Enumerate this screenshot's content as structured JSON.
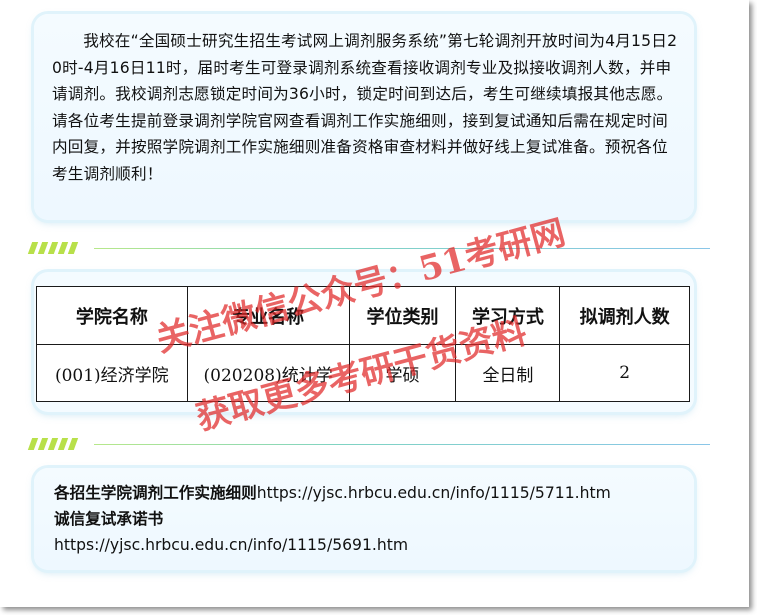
{
  "notice": {
    "text": "我校在“全国硕士研究生招生考试网上调剂服务系统”第七轮调剂开放时间为4月15日20时-4月16日11时，届时考生可登录调剂系统查看接收调剂专业及拟接收调剂人数，并申请调剂。我校调剂志愿锁定时间为36小时，锁定时间到达后，考生可继续填报其他志愿。请各位考生提前登录调剂学院官网查看调剂工作实施细则，接到复试通知后需在规定时间内回复，并按照学院调剂工作实施细则准备资格审查材料并做好线上复试准备。预祝各位考生调剂顺利！"
  },
  "table": {
    "headers": [
      "学院名称",
      "专业名称",
      "学位类别",
      "学习方式",
      "拟调剂人数"
    ],
    "rows": [
      [
        "(001)经济学院",
        "(020208)统计学",
        "学硕",
        "全日制",
        "2"
      ]
    ]
  },
  "links": {
    "rule_label": "各招生学院调剂工作实施细则",
    "rule_url": "https://yjsc.hrbcu.edu.cn/info/1115/5711.htm",
    "pledge_label": "诚信复试承诺书",
    "pledge_url": "https://yjsc.hrbcu.edu.cn/info/1115/5691.htm"
  },
  "watermark": {
    "line1": "关注微信公众号：51考研网",
    "line2": "获取更多考研干货资料"
  },
  "colors": {
    "accent_green": "#b8e04a",
    "card_bg": "#f4fbff",
    "watermark_red": "#e02828"
  }
}
